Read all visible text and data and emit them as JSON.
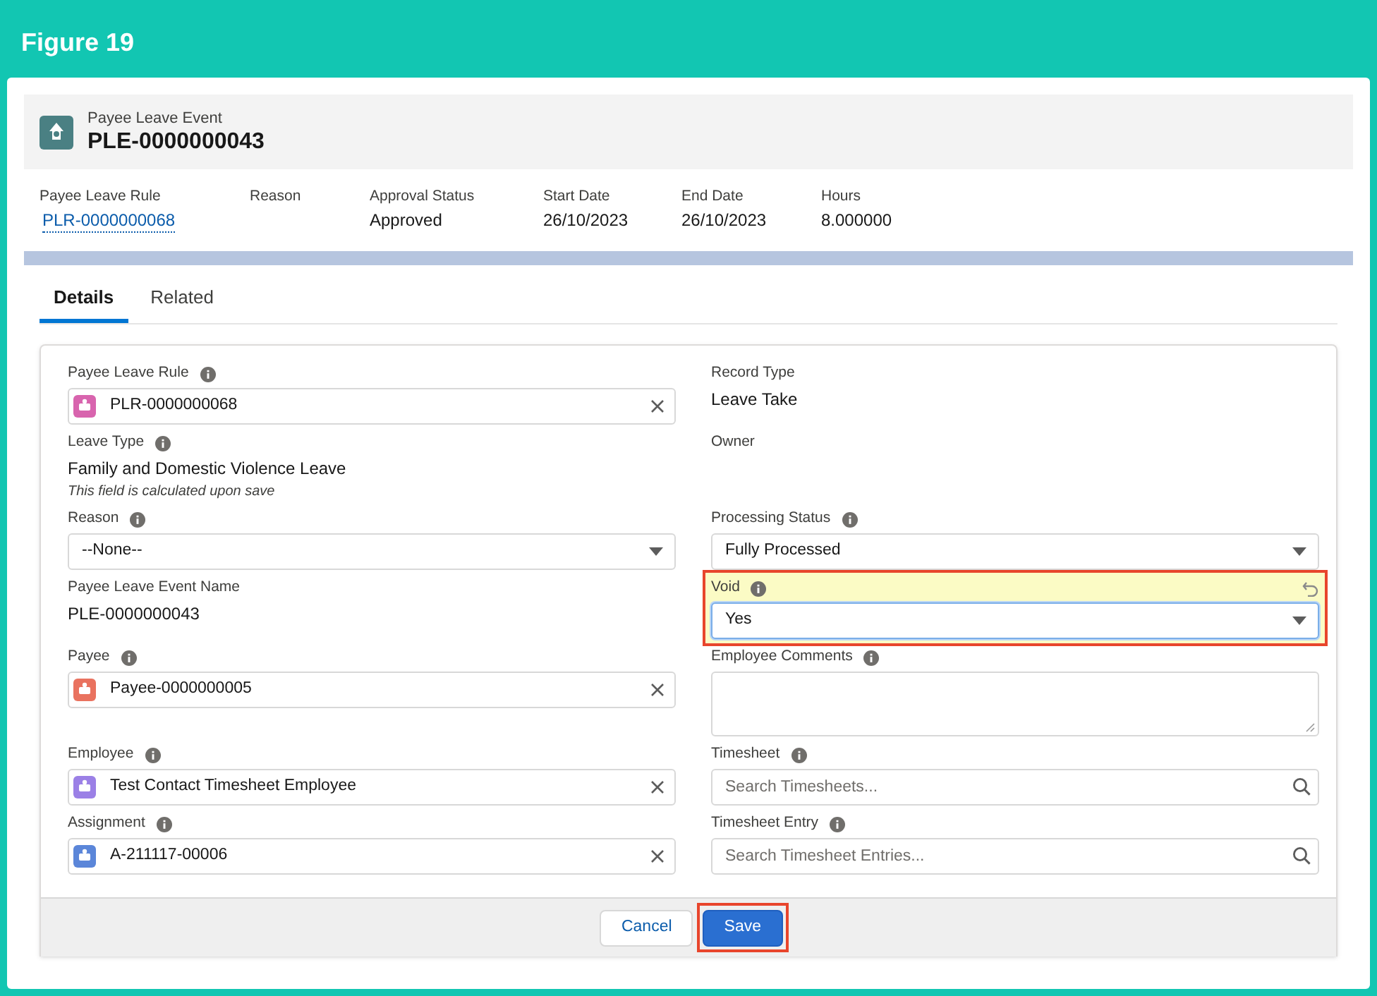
{
  "figure": {
    "title": "Figure 19"
  },
  "record": {
    "object_label": "Payee Leave Event",
    "name": "PLE-0000000043"
  },
  "highlights": [
    {
      "label": "Payee Leave Rule",
      "value": "PLR-0000000068",
      "kind": "link"
    },
    {
      "label": "Reason"
    },
    {
      "label": "Approval Status",
      "value": "Approved",
      "kind": "text"
    },
    {
      "label": "Start Date",
      "value": "26/10/2023",
      "kind": "text"
    },
    {
      "label": "End Date",
      "value": "26/10/2023",
      "kind": "text"
    },
    {
      "label": "Hours",
      "value": "8.000000",
      "kind": "text"
    }
  ],
  "tabs": [
    {
      "label": "Details",
      "selected": true
    },
    {
      "label": "Related",
      "selected": false
    }
  ],
  "form": {
    "rows": [
      [
        {
          "kind": "lookup",
          "label": "Payee Leave Rule",
          "info": true,
          "value": "PLR-0000000068",
          "color": "#d864ae"
        },
        {
          "kind": "readonly",
          "label": "Record Type",
          "info": false,
          "value": "Leave Take"
        }
      ],
      [
        {
          "kind": "readonly",
          "label": "Leave Type",
          "info": true,
          "value": "Family and Domestic Violence Leave",
          "note": "This field is calculated upon save"
        },
        {
          "kind": "readonly",
          "label": "Owner",
          "info": false
        }
      ],
      [
        {
          "kind": "select",
          "label": "Reason",
          "info": true,
          "value": "--None--",
          "changed": false
        },
        {
          "kind": "select",
          "label": "Processing Status",
          "info": true,
          "value": "Fully Processed",
          "changed": false
        }
      ],
      [
        {
          "kind": "readonly",
          "label": "Payee Leave Event Name",
          "info": false,
          "value": "PLE-0000000043"
        },
        {
          "kind": "select",
          "label": "Void",
          "info": true,
          "value": "Yes",
          "changed": true,
          "highlighted": true
        }
      ],
      [
        {
          "kind": "lookup",
          "label": "Payee",
          "info": true,
          "value": "Payee-0000000005",
          "color": "#e9725f"
        },
        {
          "kind": "textarea",
          "label": "Employee Comments",
          "info": true
        }
      ],
      [
        {
          "kind": "lookup",
          "label": "Employee",
          "info": true,
          "value": "Test Contact Timesheet Employee",
          "color": "#9b80e6"
        },
        {
          "kind": "search",
          "label": "Timesheet",
          "info": true,
          "placeholder": "Search Timesheets..."
        }
      ],
      [
        {
          "kind": "lookup",
          "label": "Assignment",
          "info": true,
          "value": "A-211117-00006",
          "color": "#5b86d9"
        },
        {
          "kind": "search",
          "label": "Timesheet Entry",
          "info": true,
          "placeholder": "Search Timesheet Entries..."
        }
      ]
    ]
  },
  "footer": {
    "buttons": [
      {
        "label": "Cancel",
        "kind": "neutral",
        "highlighted": false
      },
      {
        "label": "Save",
        "kind": "brand",
        "highlighted": true
      }
    ]
  }
}
